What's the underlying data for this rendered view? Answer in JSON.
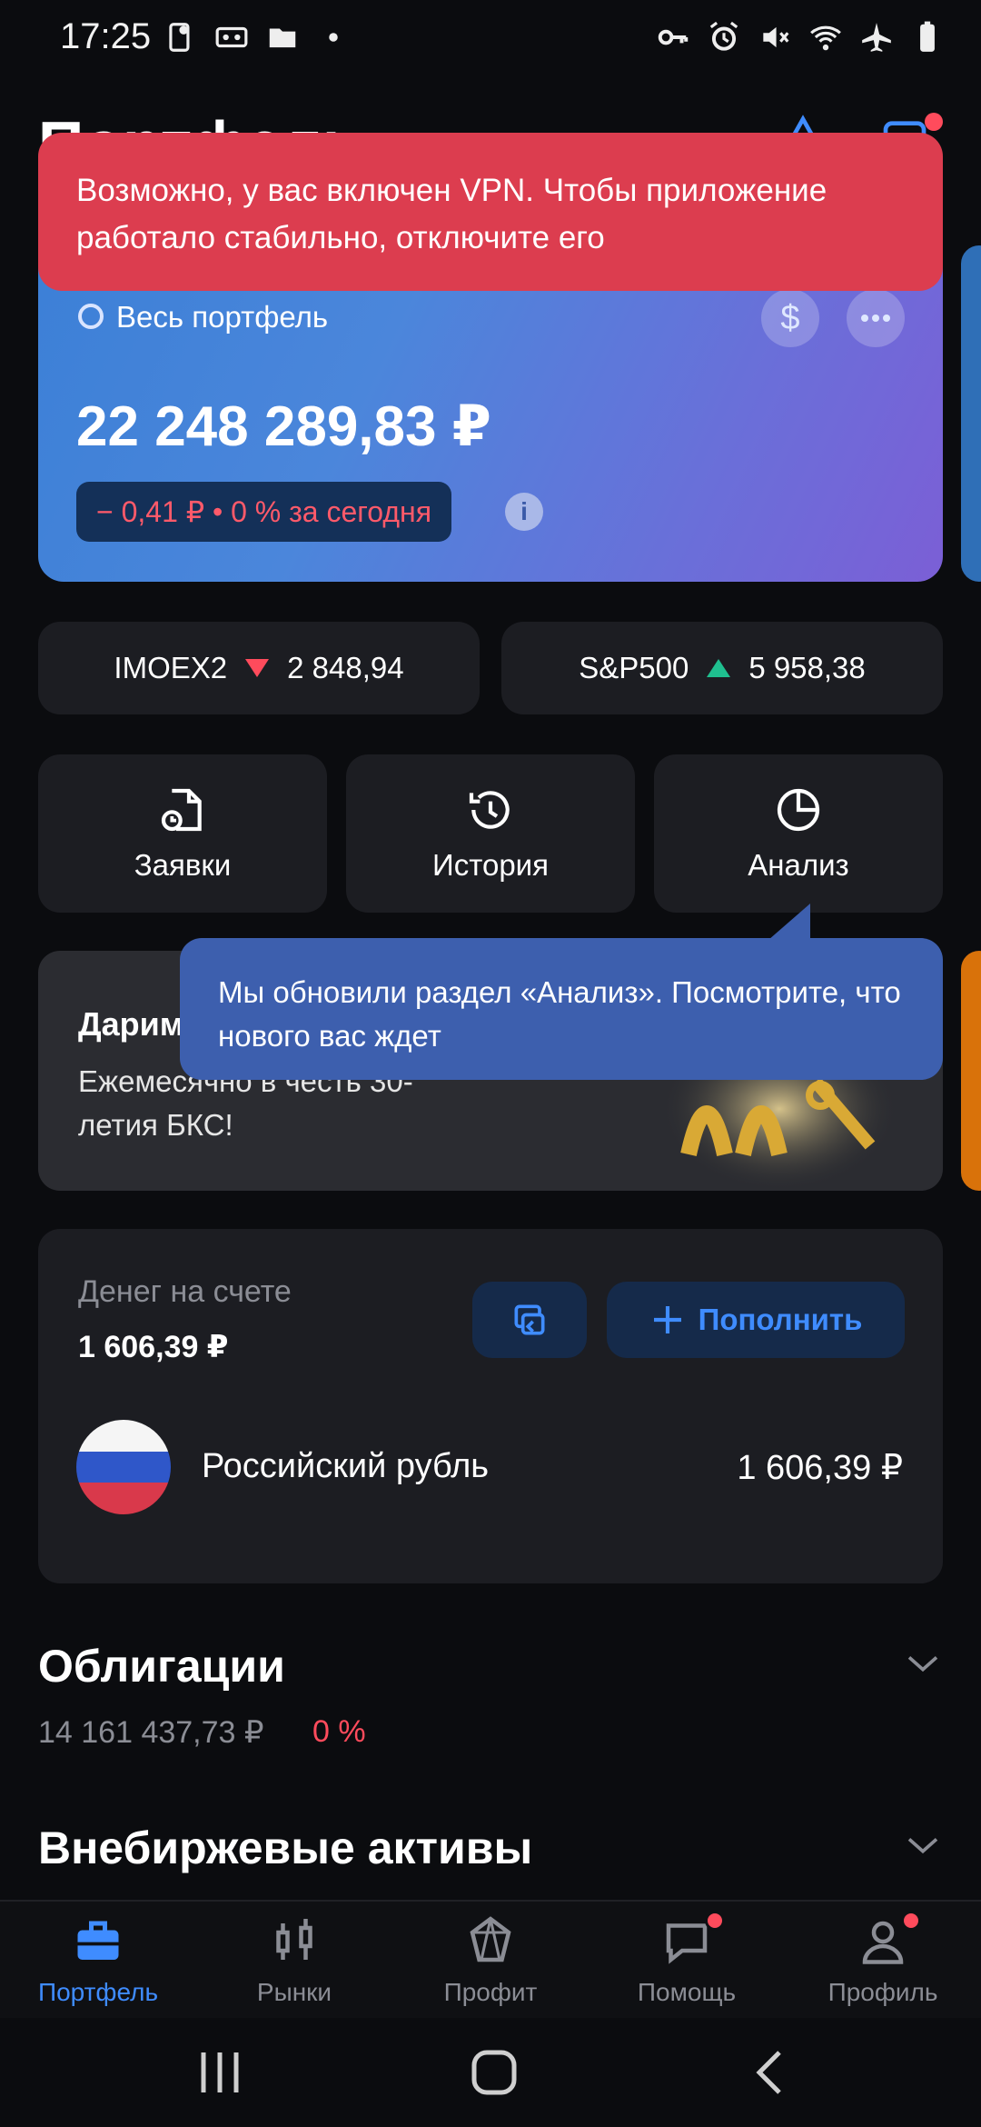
{
  "status_bar": {
    "time": "17:25"
  },
  "header": {
    "title": "Портфель"
  },
  "vpn_banner": {
    "text": "Возможно, у вас включен VPN. Чтобы приложение работало стабильно, отключите его"
  },
  "portfolio": {
    "selector_label": "Весь портфель",
    "currency_symbol": "$",
    "amount": "22 248 289,83 ₽",
    "change": "− 0,41 ₽ • 0 % за сегодня",
    "info_symbol": "i"
  },
  "indices": [
    {
      "name": "IMOEX2",
      "value": "2 848,94",
      "direction": "down"
    },
    {
      "name": "S&P500",
      "value": "5 958,38",
      "direction": "up"
    }
  ],
  "actions": {
    "orders": "Заявки",
    "history": "История",
    "analysis": "Анализ"
  },
  "promo": {
    "title": "Дарим",
    "text": "Ежемесячно в честь 30-летия БКС!"
  },
  "tooltip": {
    "text": "Мы обновили раздел «Анализ». Посмотрите, что нового вас ждет"
  },
  "money": {
    "label": "Денег на счете",
    "value": "1 606,39 ₽",
    "add_button": "Пополнить",
    "currency_name": "Российский рубль",
    "currency_amount": "1 606,39 ₽"
  },
  "sections": {
    "bonds_title": "Облигации",
    "bonds_sum": "14 161 437,73 ₽",
    "bonds_change": "0 %",
    "otc_title": "Внебиржевые активы"
  },
  "bottom_nav": {
    "portfolio": "Портфель",
    "markets": "Рынки",
    "profit": "Профит",
    "help": "Помощь",
    "profile": "Профиль"
  },
  "colors": {
    "accent": "#3f8cff",
    "negative": "#ff4b5c",
    "positive": "#1fbf8f",
    "vpn_banner": "#dc3d4f",
    "tooltip": "#3d5fae"
  }
}
